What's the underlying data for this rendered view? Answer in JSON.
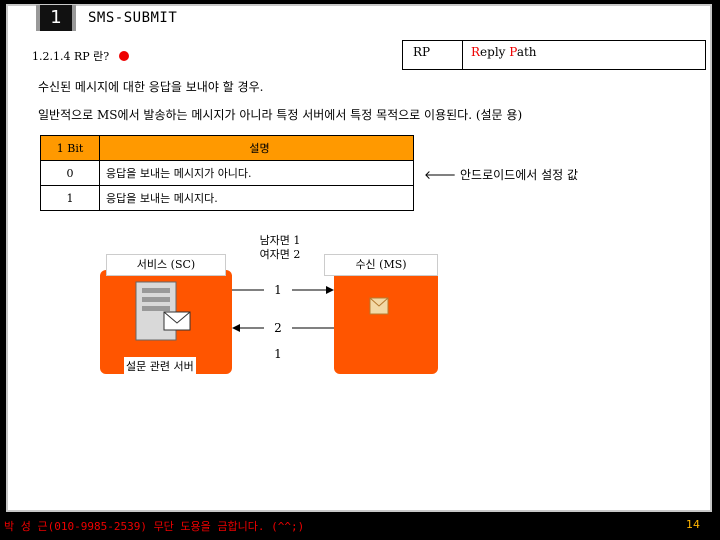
{
  "slide": {
    "number": "1",
    "title": "SMS-SUBMIT",
    "section": "1.2.1.4 RP 란?",
    "rp_abbr": "RP",
    "rp_full_first": "R",
    "rp_full_mid": "eply ",
    "rp_full_p": "P",
    "rp_full_rest": "ath",
    "line1": "수신된 메시지에 대한 응답을 보내야 할 경우.",
    "line2": "일반적으로 MS에서 발송하는 메시지가 아니라 특정 서버에서 특정 목적으로 이용된다. (설문 용)",
    "android_note": "🡐 안드로이드에서 설정 값"
  },
  "bit_table": {
    "header": [
      "1 Bit",
      "설명"
    ],
    "rows": [
      [
        "0",
        "응답을 보내는 메시지가 아니다."
      ],
      [
        "1",
        "응답을 보내는 메시지다."
      ]
    ]
  },
  "diagram": {
    "service_label": "서비스 (SC)",
    "receiver_label": "수신 (MS)",
    "gender_male": "남자면 1",
    "gender_female": "여자면 2",
    "arrow1": "1",
    "arrow2": "2",
    "reply_value": "1",
    "server_label": "설문 관련 서버"
  },
  "footer": {
    "author": "박 성 근(010-9985-2539) 무단 도용을 금합니다. (^^;)",
    "page": "14"
  },
  "colors": {
    "accent_orange": "#ff5500",
    "header_orange": "#ff9900",
    "highlight_red": "#ee0000"
  }
}
